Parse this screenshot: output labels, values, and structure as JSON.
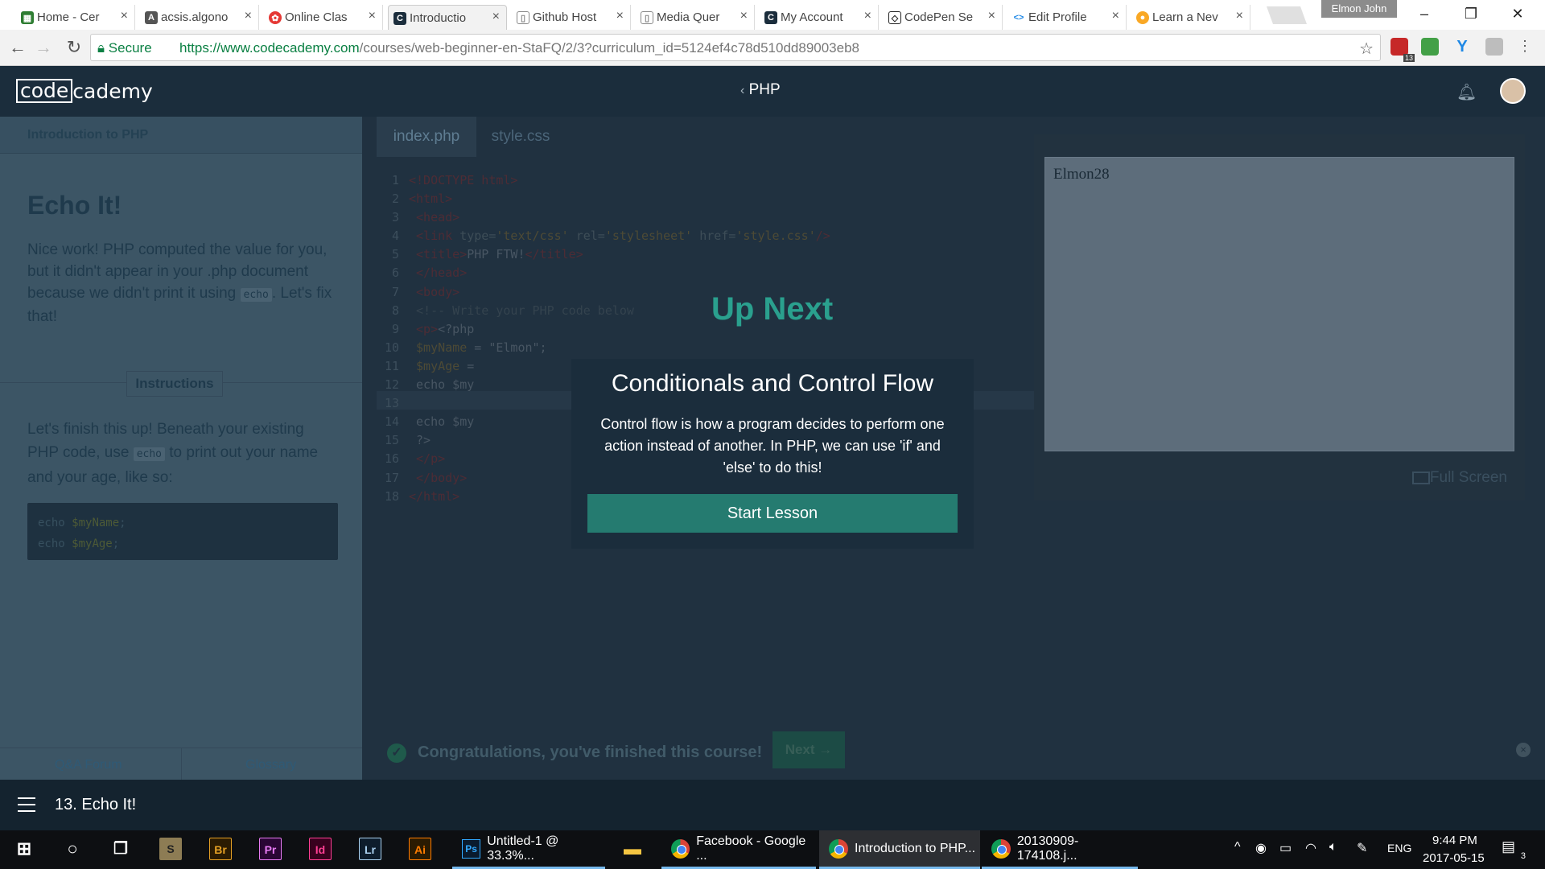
{
  "browser": {
    "tabs": [
      {
        "label": "Home - Cer",
        "icon": "grid-logo-icon",
        "color": "#2e7d32"
      },
      {
        "label": "acsis.algono",
        "icon": "a-logo-icon",
        "color": "#555555"
      },
      {
        "label": "Online Clas",
        "icon": "flower-logo-icon",
        "color": "#e53935"
      },
      {
        "label": "Introductio",
        "icon": "codecademy-icon",
        "color": "#1b2d3c"
      },
      {
        "label": "Github Host",
        "icon": "page-icon",
        "color": "#888888"
      },
      {
        "label": "Media Quer",
        "icon": "page-icon",
        "color": "#888888"
      },
      {
        "label": "My Account",
        "icon": "codecademy-icon",
        "color": "#1b2d3c"
      },
      {
        "label": "CodePen Se",
        "icon": "codepen-icon",
        "color": "#222222"
      },
      {
        "label": "Edit Profile",
        "icon": "code-brackets-icon",
        "color": "#1e88e5"
      },
      {
        "label": "Learn a Nev",
        "icon": "person-icon",
        "color": "#f9a825"
      }
    ],
    "user_chip": "Elmon John",
    "secure_label": "Secure",
    "url_domain": "https://www.codecademy.com",
    "url_path": "/courses/web-beginner-en-StaFQ/2/3?curriculum_id=5124ef4c78d510dd89003eb8"
  },
  "header": {
    "logo_code": "code",
    "logo_rest": "cademy",
    "course": "PHP",
    "back_chevron": "‹"
  },
  "lesson": {
    "course_name": "Introduction to PHP",
    "title": "Echo It!",
    "intro_1": "Nice work! PHP computed the value for you, but it didn't appear in your .php document because we didn't print it using ",
    "intro_code": "echo",
    "intro_2": ". Let's fix that!",
    "instructions_label": "Instructions",
    "instr_1": "Let's finish this up! Beneath your existing PHP code, use ",
    "instr_code": "echo",
    "instr_2": " to print out your name and your age, like so:",
    "example_kw_1": "echo ",
    "example_var_1": "$myName",
    "example_kw_2": "echo ",
    "example_var_2": "$myAge",
    "qa_forum": "Q&A Forum",
    "glossary": "Glossary"
  },
  "editor": {
    "tabs": [
      "index.php",
      "style.css"
    ],
    "line_numbers": [
      "1",
      "2",
      "3",
      "4",
      "5",
      "6",
      "7",
      "8",
      "9",
      "10",
      "11",
      "12",
      "13",
      "14",
      "15",
      "16",
      "17",
      "18"
    ]
  },
  "preview": {
    "output": "Elmon28",
    "fullscreen_label": "Full Screen"
  },
  "status": {
    "congrats": "Congratulations, you've finished this course!",
    "next_label": "Next →"
  },
  "modal": {
    "up_next": "Up Next",
    "title": "Conditionals and Control Flow",
    "description": "Control flow is how a program decides to perform one action instead of another. In PHP, we can use 'if' and 'else' to do this!",
    "button": "Start Lesson"
  },
  "footer": {
    "lesson_label": "13. Echo It!"
  },
  "taskbar": {
    "pinned": [
      "Br",
      "Pr",
      "Id",
      "Lr",
      "Ai"
    ],
    "apps": [
      "Untitled-1 @ 33.3%...",
      "Facebook - Google ...",
      "Introduction to PHP...",
      "20130909-174108.j..."
    ],
    "lang": "ENG",
    "time": "9:44 PM",
    "date": "2017-05-15",
    "notif_count": "3",
    "ext_badge": "13"
  }
}
